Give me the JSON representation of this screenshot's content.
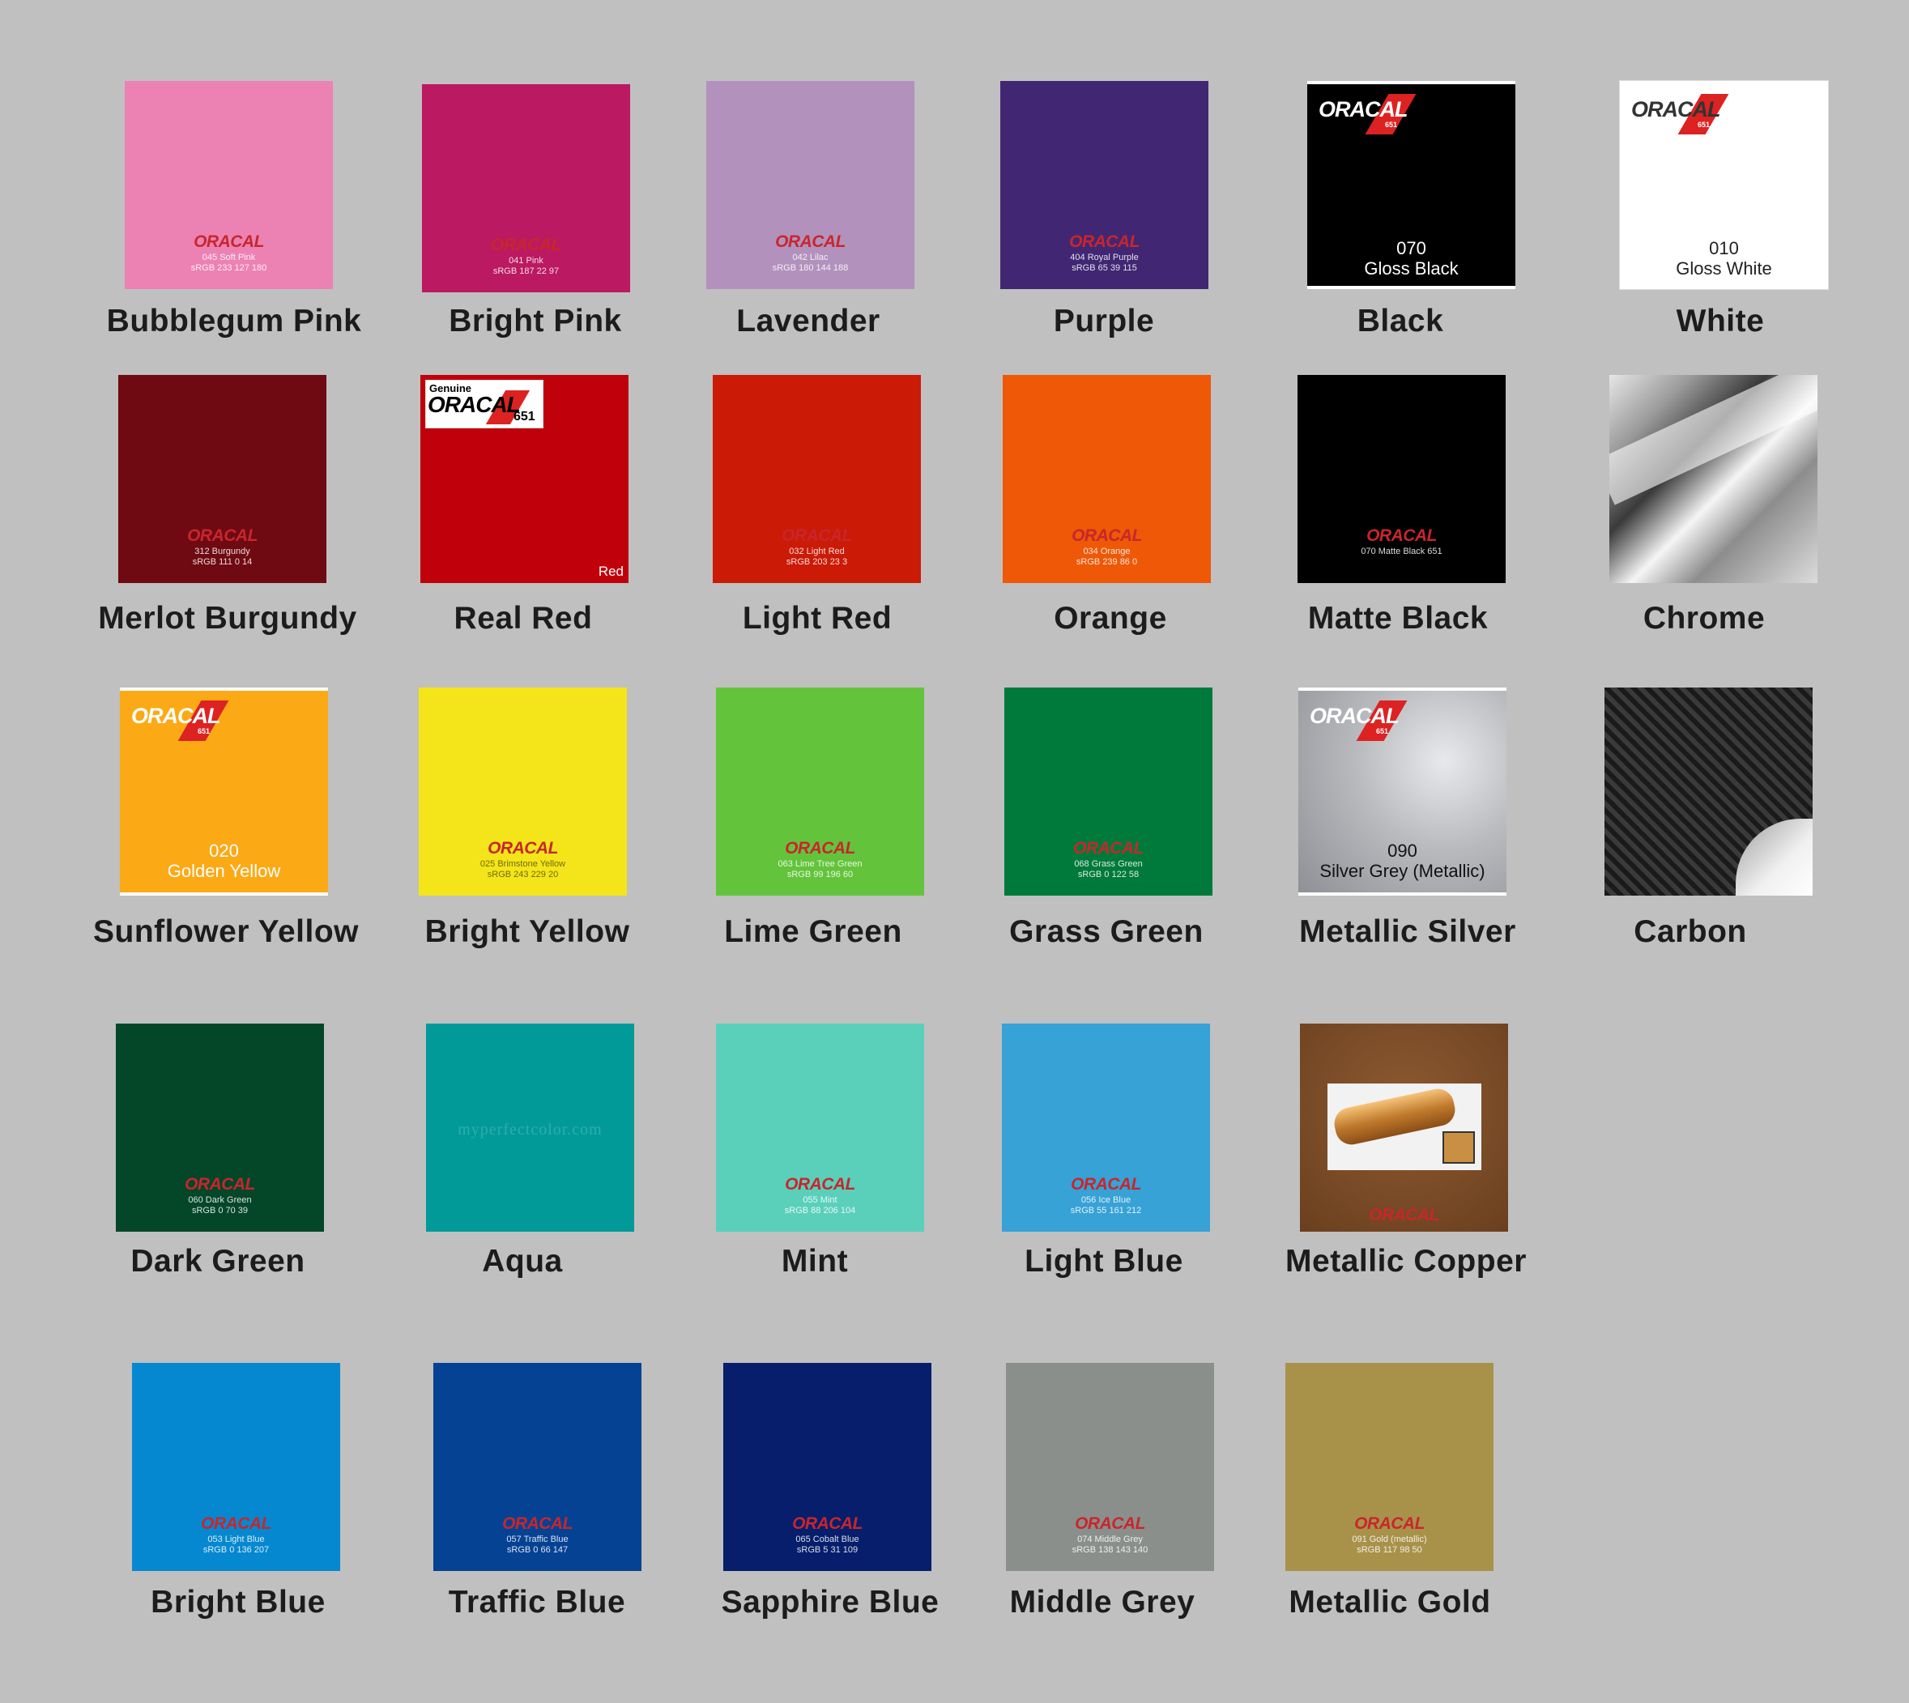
{
  "brand": "ORACAL",
  "brand_sub": "651",
  "genuine_label": "Genuine",
  "watermark": "myperfectcolor.com",
  "swatches": [
    {
      "title": "Bubblegum Pink",
      "color": "#ec82b4",
      "code1": "045 Soft Pink",
      "code2": "sRGB 233 127 180"
    },
    {
      "title": "Bright Pink",
      "color": "#bb1961",
      "code1": "041 Pink",
      "code2": "sRGB 187 22 97"
    },
    {
      "title": "Lavender",
      "color": "#b391bd",
      "code1": "042 Lilac",
      "code2": "sRGB 180 144 188"
    },
    {
      "title": "Purple",
      "color": "#412773",
      "code1": "404 Royal Purple",
      "code2": "sRGB 65 39 115"
    },
    {
      "title": "Black",
      "color": "#000000",
      "code1": "070",
      "code2": "Gloss Black"
    },
    {
      "title": "White",
      "color": "#ffffff",
      "code1": "010",
      "code2": "Gloss White"
    },
    {
      "title": "Merlot Burgundy",
      "color": "#6f0a12",
      "code1": "312 Burgundy",
      "code2": "sRGB 111 0 14"
    },
    {
      "title": "Real Red",
      "color": "#c0000a",
      "corner": "Red"
    },
    {
      "title": "Light Red",
      "color": "#cb1a06",
      "code1": "032 Light Red",
      "code2": "sRGB 203 23 3"
    },
    {
      "title": "Orange",
      "color": "#ee5806",
      "code1": "034 Orange",
      "code2": "sRGB 239 86 0"
    },
    {
      "title": "Matte Black",
      "color": "#000000",
      "code1": "070 Matte Black 651",
      "code2": ""
    },
    {
      "title": "Chrome",
      "color": "#b6b6b6"
    },
    {
      "title": "Sunflower Yellow",
      "color": "#fca916",
      "code1": "020",
      "code2": "Golden Yellow"
    },
    {
      "title": "Bright Yellow",
      "color": "#f3e519",
      "code1": "025 Brimstone Yellow",
      "code2": "sRGB 243 229 20"
    },
    {
      "title": "Lime Green",
      "color": "#63c43c",
      "code1": "063 Lime Tree Green",
      "code2": "sRGB 99 196 60"
    },
    {
      "title": "Grass Green",
      "color": "#007a3a",
      "code1": "068 Grass Green",
      "code2": "sRGB 0 122 58"
    },
    {
      "title": "Metallic Silver",
      "color": "#a8a9ad",
      "code1": "090",
      "code2": "Silver Grey (Metallic)"
    },
    {
      "title": "Carbon",
      "color": "#2a2a2a"
    },
    {
      "title": "Dark Green",
      "color": "#034628",
      "code1": "060 Dark Green",
      "code2": "sRGB 0 70 39"
    },
    {
      "title": "Aqua",
      "color": "#019a98"
    },
    {
      "title": "Mint",
      "color": "#5ad0bb",
      "code1": "055 Mint",
      "code2": "sRGB 88 206 104"
    },
    {
      "title": "Light Blue",
      "color": "#37a2d6",
      "code1": "056 Ice Blue",
      "code2": "sRGB 55 161 212"
    },
    {
      "title": "Metallic Copper",
      "color": "#7a4a28"
    },
    {
      "title": "Bright Blue",
      "color": "#0688d0",
      "code1": "053 Light Blue",
      "code2": "sRGB 0 136 207"
    },
    {
      "title": "Traffic Blue",
      "color": "#064293",
      "code1": "057 Traffic Blue",
      "code2": "sRGB 0 66 147"
    },
    {
      "title": "Sapphire Blue",
      "color": "#061e6c",
      "code1": "065 Cobalt Blue",
      "code2": "sRGB 5 31 109"
    },
    {
      "title": "Middle Grey",
      "color": "#8a8f8c",
      "code1": "074 Middle Grey",
      "code2": "sRGB 138 143 140"
    },
    {
      "title": "Metallic Gold",
      "color": "#a8924a",
      "code1": "091 Gold (metallic)",
      "code2": "sRGB 117 98 50"
    }
  ]
}
